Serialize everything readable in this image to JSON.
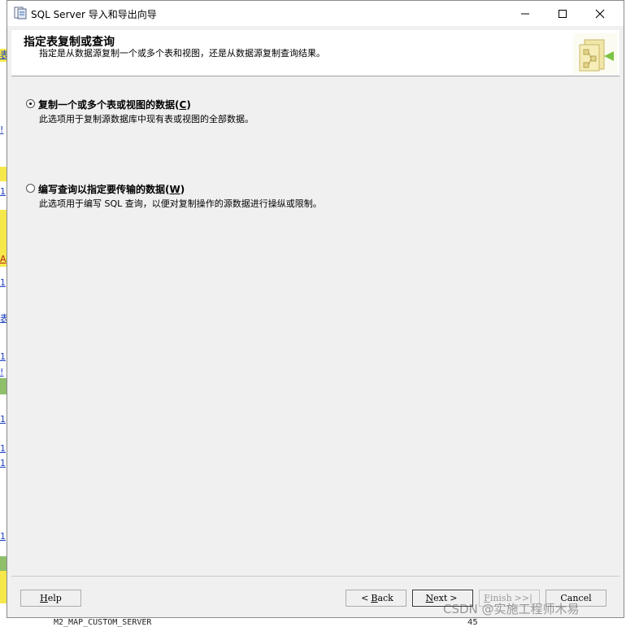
{
  "window": {
    "title": "SQL Server 导入和导出向导",
    "minimize_icon": "minimize-icon",
    "maximize_icon": "maximize-icon",
    "close_icon": "close-icon"
  },
  "header": {
    "title": "指定表复制或查询",
    "description": "指定是从数据源复制一个或多个表和视图，还是从数据源复制查询结果。",
    "art_icon": "wizard-table-icon"
  },
  "options": [
    {
      "label": "复制一个或多个表或视图的数据(",
      "mnemonic": "C",
      "label_suffix": ")",
      "description": "此选项用于复制源数据库中现有表或视图的全部数据。",
      "checked": true
    },
    {
      "label": "编写查询以指定要传输的数据(",
      "mnemonic": "W",
      "label_suffix": ")",
      "description": "此选项用于编写 SQL 查询，以便对复制操作的源数据进行操纵或限制。",
      "checked": false
    }
  ],
  "buttons": {
    "help": {
      "mn": "H",
      "rest": "elp"
    },
    "back": {
      "arrow": "<",
      "mn": "B",
      "rest": "ack"
    },
    "next": {
      "mn": "N",
      "rest": "ext",
      "arrow": ">"
    },
    "finish": {
      "mn": "F",
      "rest": "inish",
      "arrow": ">>|"
    },
    "cancel": {
      "label": "Cancel"
    }
  },
  "background": {
    "edge_chars": [
      "表",
      "!",
      "1",
      "A",
      "1",
      "表",
      "1",
      "!",
      "1",
      "1",
      "1",
      "1"
    ],
    "bottom_text": "M2_MAP_CUSTOM_SERVER",
    "bottom_number": "45"
  },
  "watermark": "CSDN @实施工程师木易",
  "colors": {
    "window_bg": "#f0f0f0",
    "header_bg": "#ffffff",
    "background_green": "#8fbf6a",
    "background_yellow": "#f6e84a"
  }
}
